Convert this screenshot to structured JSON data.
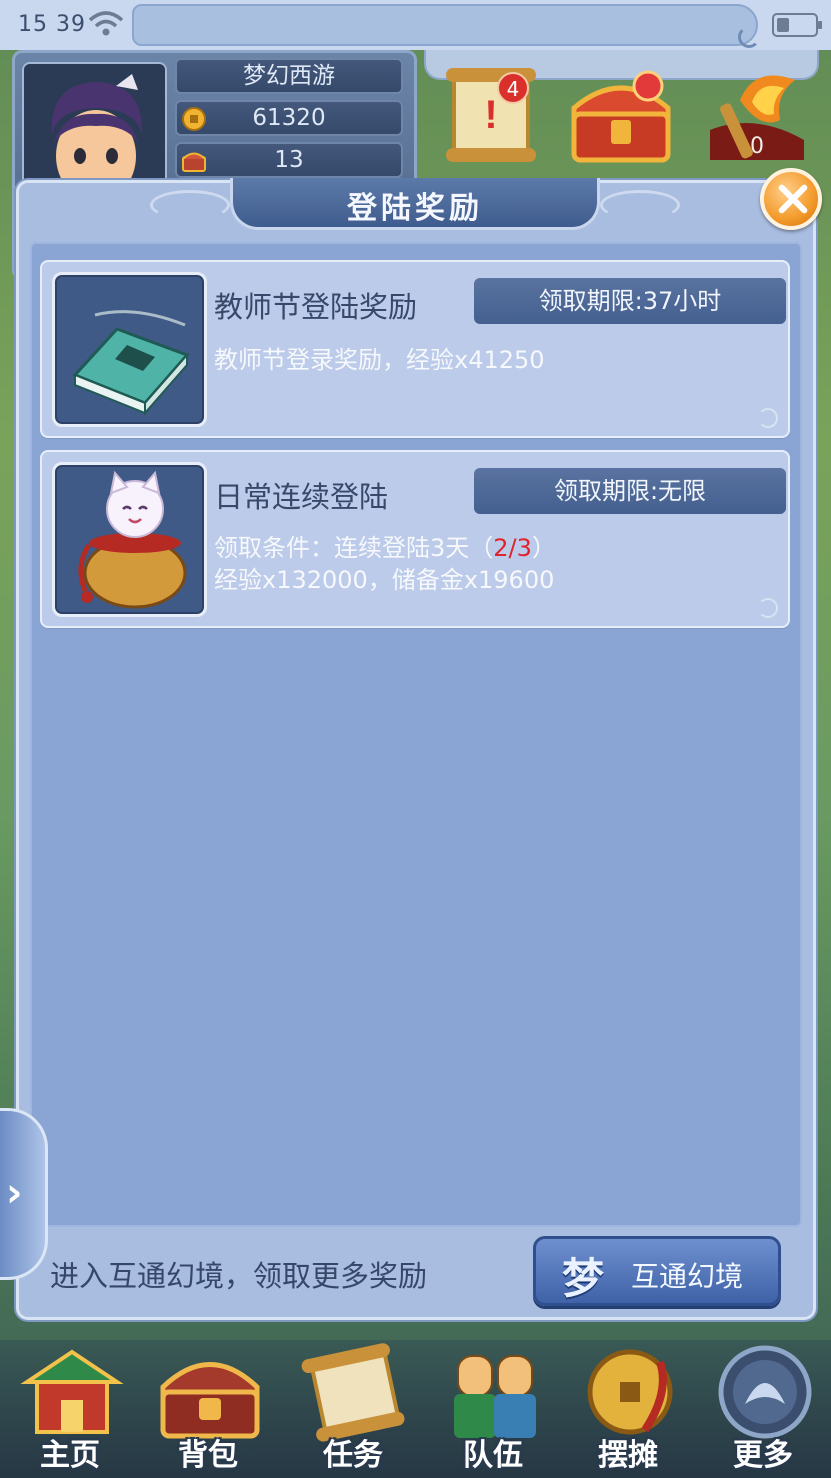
{
  "status_bar": {
    "time": "15 39"
  },
  "profile": {
    "server_name": "梦幻西游",
    "coins": "61320",
    "chests": "13"
  },
  "top_icons": {
    "quest_scroll_badge": "4",
    "torch_count": "0"
  },
  "modal": {
    "title": "登陆奖励",
    "rewards": [
      {
        "title": "教师节登陆奖励",
        "deadline": "领取期限:37小时",
        "description": "教师节登录奖励，经验x41250",
        "item_icon": "book-icon"
      },
      {
        "title": "日常连续登陆",
        "deadline": "领取期限:无限",
        "condition_prefix": "领取条件：连续登陆3天（",
        "condition_progress": "2/3",
        "condition_suffix": "）",
        "rewards_text": "经验x132000，储备金x19600",
        "item_icon": "lucky-cat-bag-icon"
      }
    ],
    "footer_text": "进入互通幻境，领取更多奖励",
    "portal_button": {
      "icon_char": "梦",
      "label": "互通幻境"
    }
  },
  "bottom_nav": [
    {
      "label": "主页",
      "icon": "home-icon"
    },
    {
      "label": "背包",
      "icon": "backpack-icon"
    },
    {
      "label": "任务",
      "icon": "quest-icon"
    },
    {
      "label": "队伍",
      "icon": "team-icon"
    },
    {
      "label": "摆摊",
      "icon": "stall-icon"
    },
    {
      "label": "更多",
      "icon": "more-icon"
    }
  ],
  "colors": {
    "modal_bg": "#a9bde0",
    "card_bg": "#bccbe9",
    "deadline_bg": "#4c6796",
    "progress_red": "#e1232a",
    "close_orange": "#f39a2b"
  }
}
